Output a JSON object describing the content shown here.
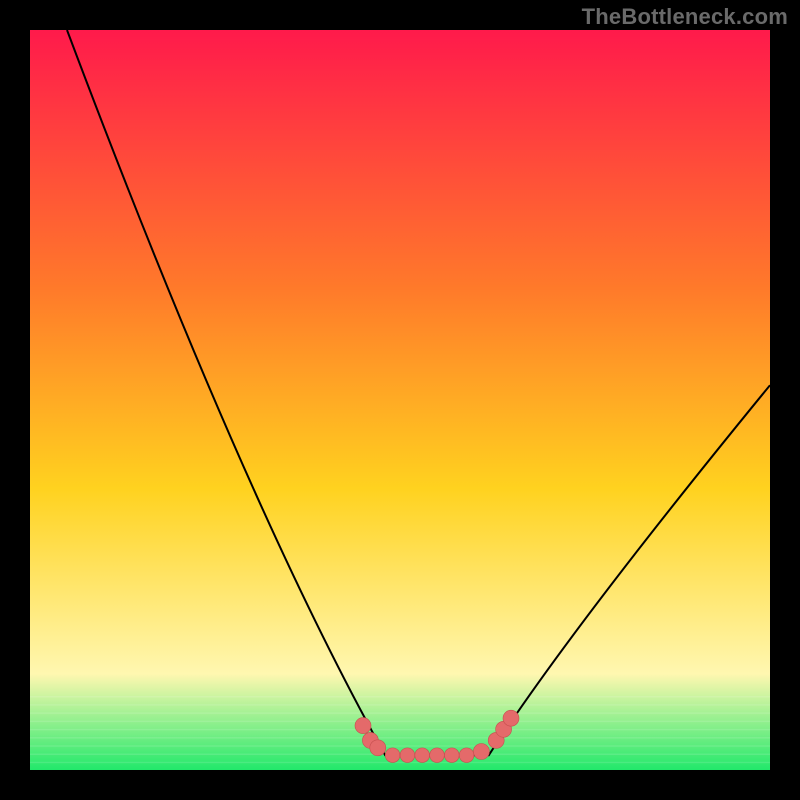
{
  "watermark": "TheBottleneck.com",
  "colors": {
    "frame": "#000000",
    "grad_top": "#ff1a4b",
    "grad_mid1": "#ff7a2a",
    "grad_mid2": "#ffd21f",
    "grad_low": "#fff7b0",
    "grad_bottom": "#22e86b",
    "curve": "#000000",
    "marker_fill": "#e46a6a",
    "marker_stroke": "#c64f4f"
  },
  "chart_data": {
    "type": "line",
    "title": "",
    "xlabel": "",
    "ylabel": "",
    "xlim": [
      0,
      100
    ],
    "ylim": [
      0,
      100
    ],
    "curve_left": [
      {
        "x": 5,
        "y": 100
      },
      {
        "x": 48,
        "y": 2
      }
    ],
    "curve_right": [
      {
        "x": 62,
        "y": 2
      },
      {
        "x": 100,
        "y": 52
      }
    ],
    "flat_bottom": {
      "x1": 48,
      "x2": 62,
      "y": 2
    },
    "markers": [
      {
        "x": 45,
        "y": 6,
        "r": 1.2
      },
      {
        "x": 46,
        "y": 4,
        "r": 1.2
      },
      {
        "x": 47,
        "y": 3,
        "r": 1.2
      },
      {
        "x": 49,
        "y": 2,
        "r": 1.1
      },
      {
        "x": 51,
        "y": 2,
        "r": 1.1
      },
      {
        "x": 53,
        "y": 2,
        "r": 1.1
      },
      {
        "x": 55,
        "y": 2,
        "r": 1.1
      },
      {
        "x": 57,
        "y": 2,
        "r": 1.1
      },
      {
        "x": 59,
        "y": 2,
        "r": 1.1
      },
      {
        "x": 61,
        "y": 2.5,
        "r": 1.2
      },
      {
        "x": 63,
        "y": 4,
        "r": 1.2
      },
      {
        "x": 64,
        "y": 5.5,
        "r": 1.2
      },
      {
        "x": 65,
        "y": 7,
        "r": 1.2
      }
    ]
  }
}
